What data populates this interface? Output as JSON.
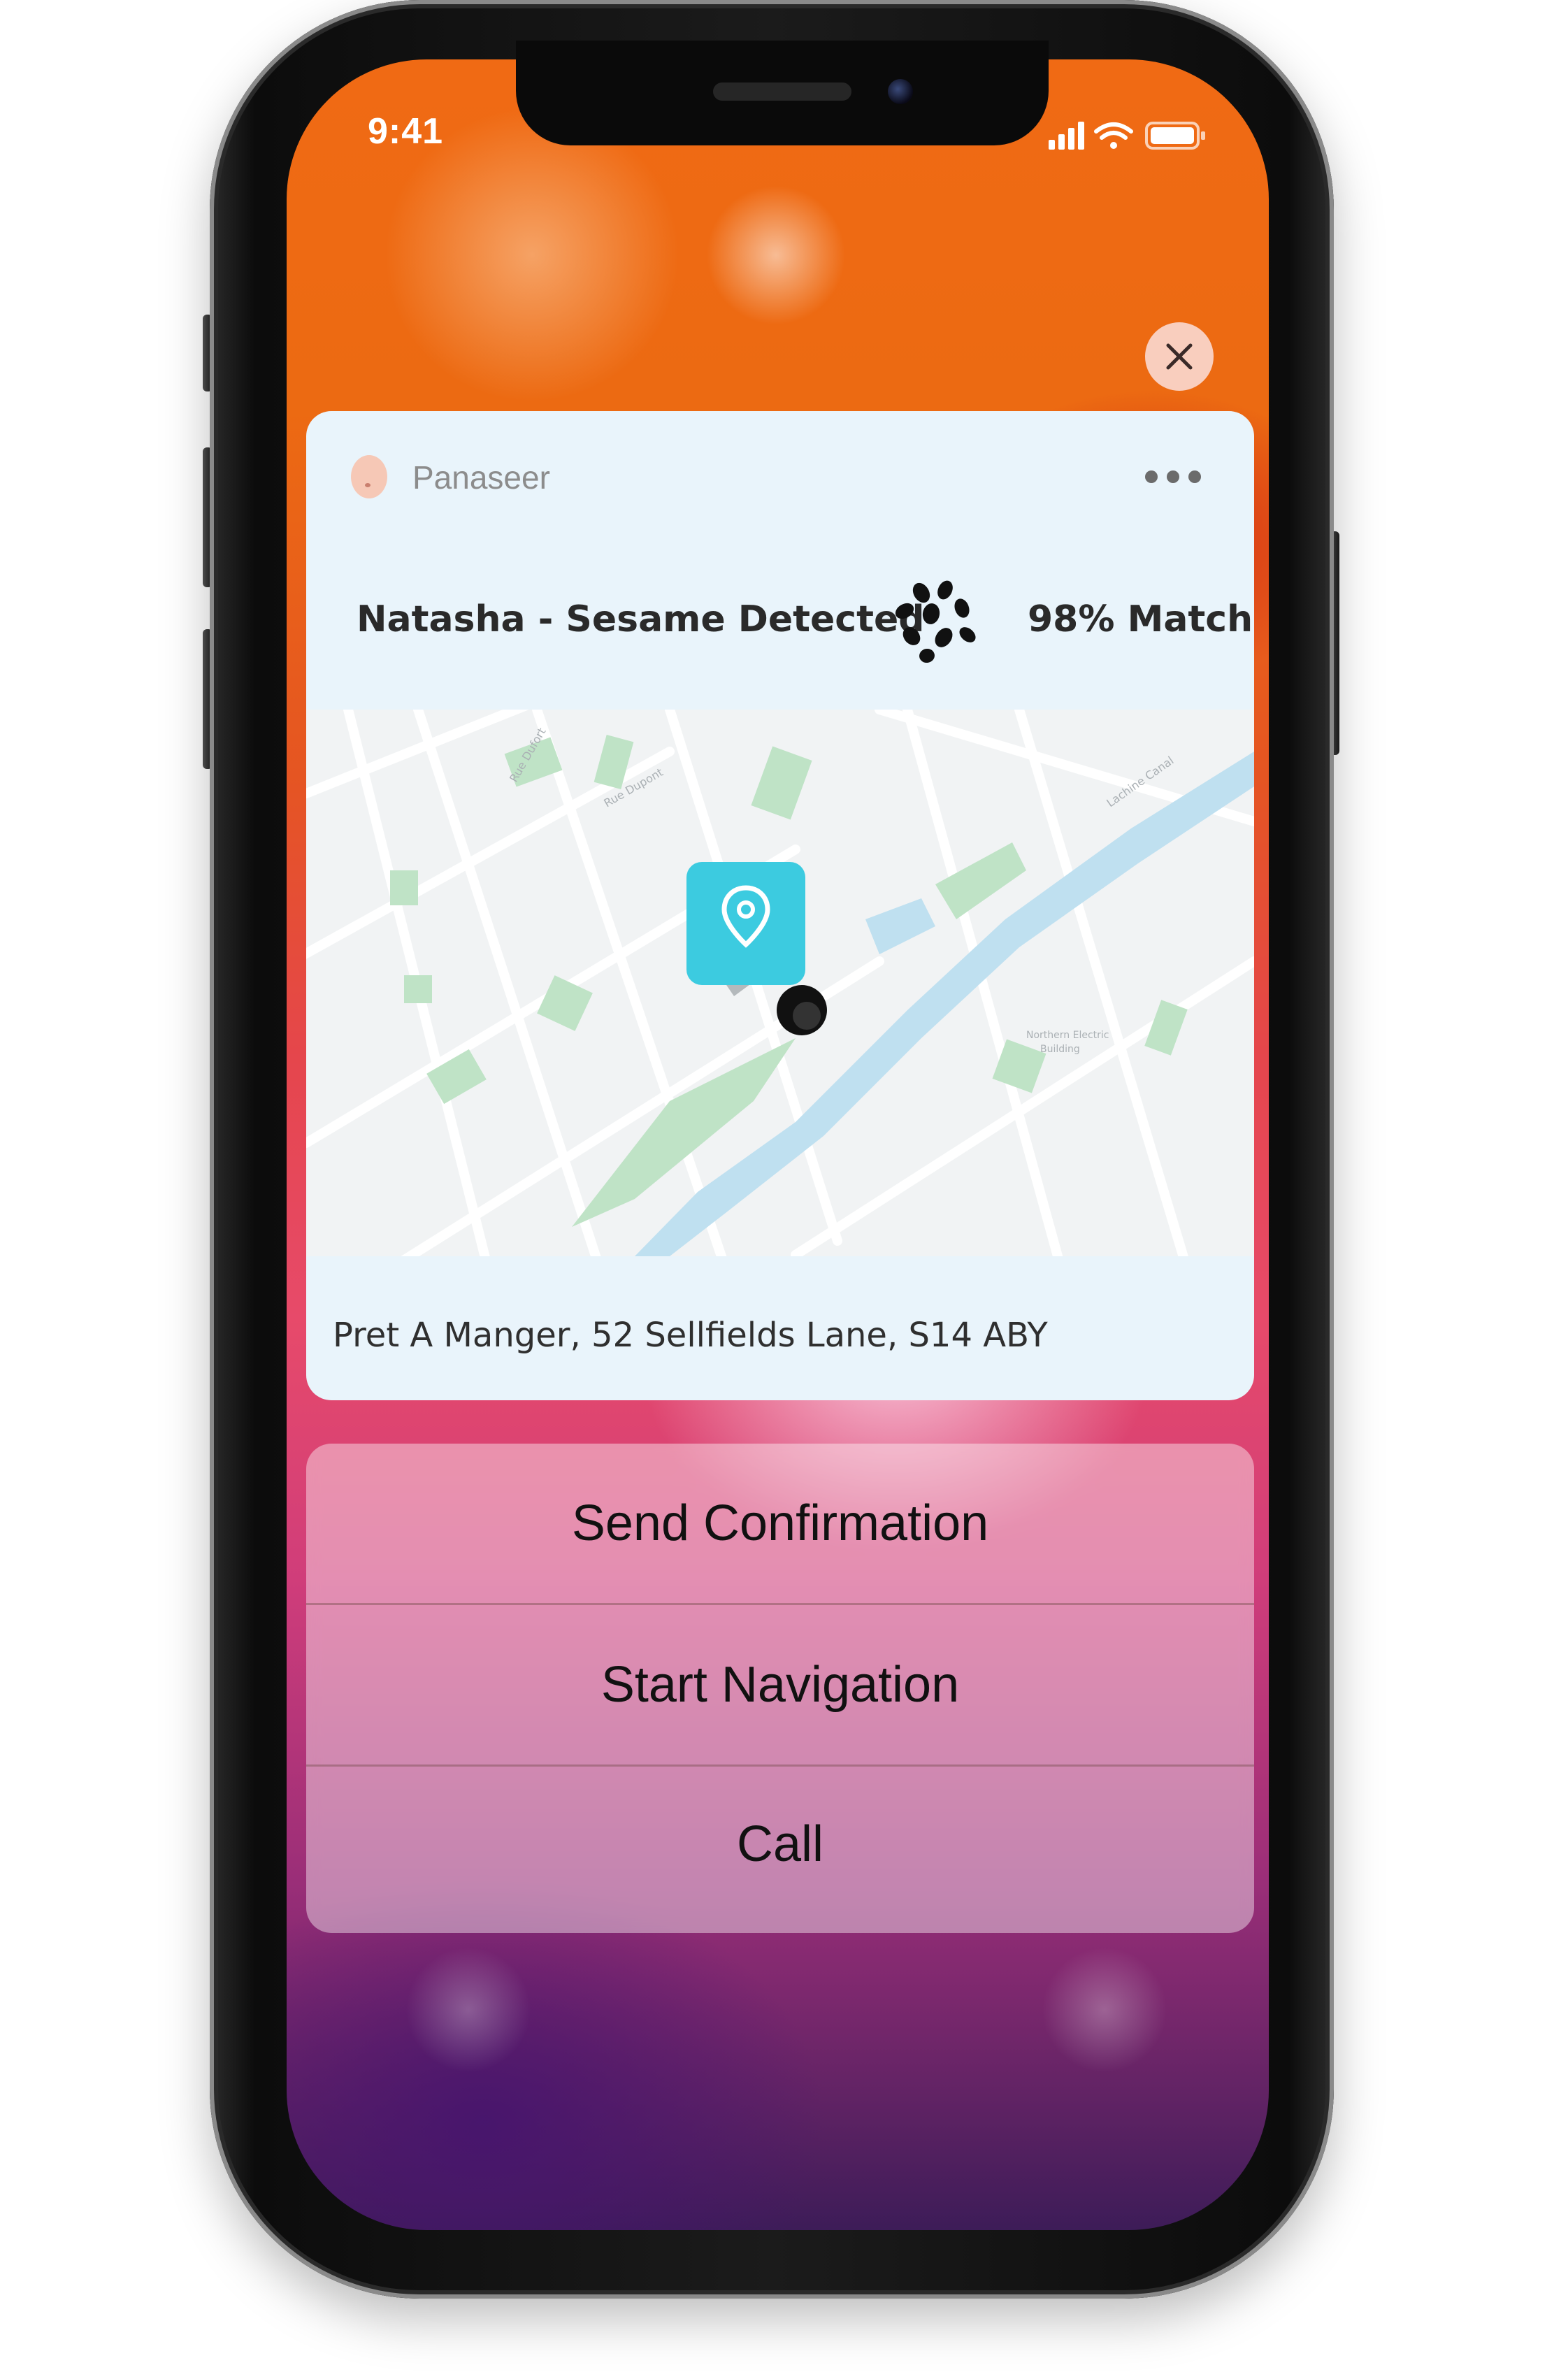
{
  "status_bar": {
    "time": "9:41",
    "icons": [
      "signal-icon",
      "wifi-icon",
      "battery-icon"
    ]
  },
  "notification": {
    "app_name": "Panaseer",
    "app_icon": "face-icon",
    "title": "Natasha - Sesame Detected",
    "allergen_icon": "sesame-seeds-icon",
    "match": "98% Match",
    "address": "Pret A Manger, 52 Sellfields Lane, S14 ABY",
    "map_pin_icon": "location-pin-icon",
    "accent_color": "#3ccbe0",
    "card_color": "#e9f4fb"
  },
  "actions": [
    {
      "label": "Send Confirmation"
    },
    {
      "label": "Start Navigation"
    },
    {
      "label": "Call"
    }
  ]
}
